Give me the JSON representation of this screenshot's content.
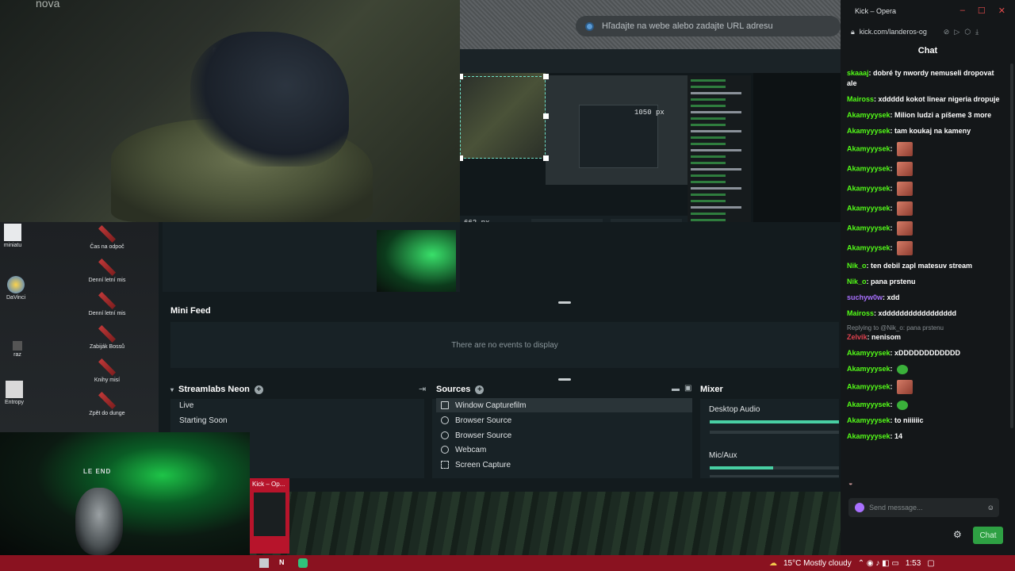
{
  "video": {
    "watermark": "nova"
  },
  "browser": {
    "url_placeholder": "Hľadajte na webe alebo zadajte URL adresu"
  },
  "preview": {
    "measure_width": "1050 px",
    "measure_height": "662 px"
  },
  "desktop_icons": [
    {
      "label": "miniatu"
    },
    {
      "label": "DaVinci"
    },
    {
      "label": "raz"
    },
    {
      "label": "Entropy"
    },
    {
      "label": "Čas na odpoč"
    },
    {
      "label": "Denní letní mis"
    },
    {
      "label": "Denní letní mis"
    },
    {
      "label": "Zabiják Bossů"
    },
    {
      "label": "Knihy misí"
    },
    {
      "label": "Zpět do dunge"
    }
  ],
  "webcam": {
    "label": "LE END"
  },
  "obs": {
    "minifeed_title": "Mini Feed",
    "minifeed_empty": "There are no events to display",
    "scenes_title": "Streamlabs Neon",
    "scenes": [
      "Live",
      "Starting Soon"
    ],
    "sources_title": "Sources",
    "sources": [
      {
        "label": "Window Capturefilm",
        "icon": "window-icon",
        "selected": true
      },
      {
        "label": "Browser Source",
        "icon": "globe-icon",
        "selected": false
      },
      {
        "label": "Browser Source",
        "icon": "globe-icon",
        "selected": false
      },
      {
        "label": "Webcam",
        "icon": "camera-icon",
        "selected": false
      },
      {
        "label": "Screen Capture",
        "icon": "screen-capture-icon",
        "selected": false
      }
    ],
    "mixer_title": "Mixer",
    "mixer": [
      {
        "label": "Desktop Audio",
        "level": 1.0
      },
      {
        "label": "Mic/Aux",
        "level": 0.49
      }
    ]
  },
  "kick_mini": {
    "title": "Kick – Op..."
  },
  "taskbar": {
    "weather": "15°C  Mostly cloudy",
    "time": "1:53"
  },
  "chat": {
    "window_title": "Kick – Opera",
    "url": "kick.com/landeros-og",
    "header": "Chat",
    "messages": [
      {
        "user": "skaaaj",
        "color": "#53fc18",
        "text": "dobré ty nwordy nemuseli dropovat ale"
      },
      {
        "user": "Maiross",
        "color": "#53fc18",
        "text": "xddddd kokot linear nigeria dropuje"
      },
      {
        "user": "Akamyyysek",
        "color": "#53fc18",
        "text": "Milion ludzi a píšeme 3 more"
      },
      {
        "user": "Akamyyysek",
        "color": "#53fc18",
        "text": "tam koukaj na kameny"
      },
      {
        "user": "Akamyyysek",
        "color": "#53fc18",
        "text": "",
        "emote": "emote"
      },
      {
        "user": "Akamyyysek",
        "color": "#53fc18",
        "text": "",
        "emote": "emote"
      },
      {
        "user": "Akamyyysek",
        "color": "#53fc18",
        "text": "",
        "emote": "emote"
      },
      {
        "user": "Akamyyysek",
        "color": "#53fc18",
        "text": "",
        "emote": "emote"
      },
      {
        "user": "Akamyyysek",
        "color": "#53fc18",
        "text": "",
        "emote": "emote"
      },
      {
        "user": "Akamyyysek",
        "color": "#53fc18",
        "text": "",
        "emote": "emote"
      },
      {
        "user": "Nik_o",
        "color": "#53fc18",
        "text": "ten debil zapl matesuv stream"
      },
      {
        "user": "Nik_o",
        "color": "#53fc18",
        "text": "pana prstenu"
      },
      {
        "user": "suchyw0w",
        "color": "#a970ff",
        "text": "xdd"
      },
      {
        "user": "Maiross",
        "color": "#53fc18",
        "text": "xddddddddddddddddd"
      },
      {
        "reply": "Replying to @Nik_o: pana prstenu",
        "user": "Zelvik",
        "color": "#e0424f",
        "text": "nenisom"
      },
      {
        "user": "Akamyyysek",
        "color": "#53fc18",
        "text": "xDDDDDDDDDDDD"
      },
      {
        "user": "Akamyyysek",
        "color": "#53fc18",
        "text": "",
        "emote": "emote-green"
      },
      {
        "user": "Akamyyysek",
        "color": "#53fc18",
        "text": "",
        "emote": "emote"
      },
      {
        "user": "Akamyyysek",
        "color": "#53fc18",
        "text": "",
        "emote": "emote-green"
      },
      {
        "user": "Akamyyysek",
        "color": "#53fc18",
        "text": "to niiiiiic"
      },
      {
        "user": "Akamyyysek",
        "color": "#53fc18",
        "text": "14"
      }
    ],
    "input_placeholder": "Send message...",
    "send_label": "Chat"
  }
}
